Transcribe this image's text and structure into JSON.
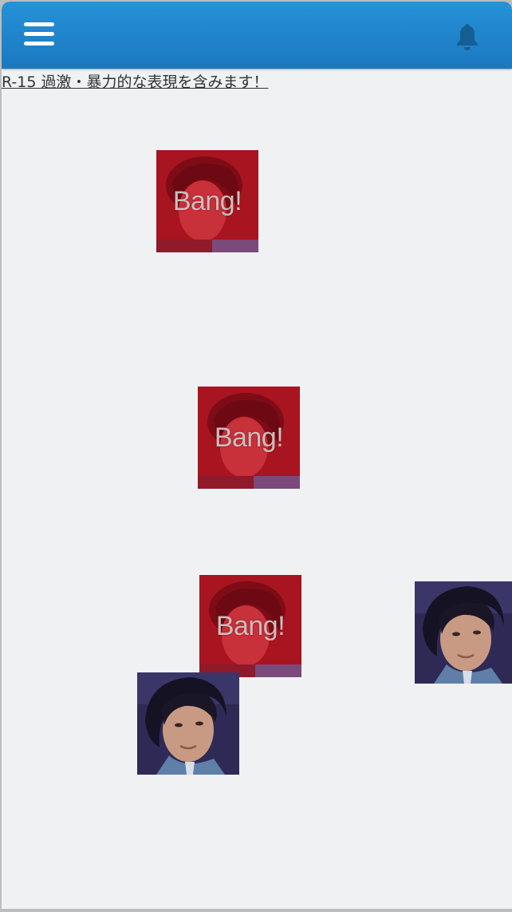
{
  "header": {
    "menu_icon": "hamburger-menu-icon",
    "notification_icon": "bell-icon",
    "background_color": "#1f86cc",
    "icon_color_menu": "#ffffff",
    "icon_color_bell": "#155e94"
  },
  "warning": {
    "text": "R-15 過激・暴力的な表現を含みます！"
  },
  "tiles": {
    "bang_label": "Bang!",
    "hit_color": "#a8141f",
    "portrait_bg_color": "#2e2a55"
  }
}
